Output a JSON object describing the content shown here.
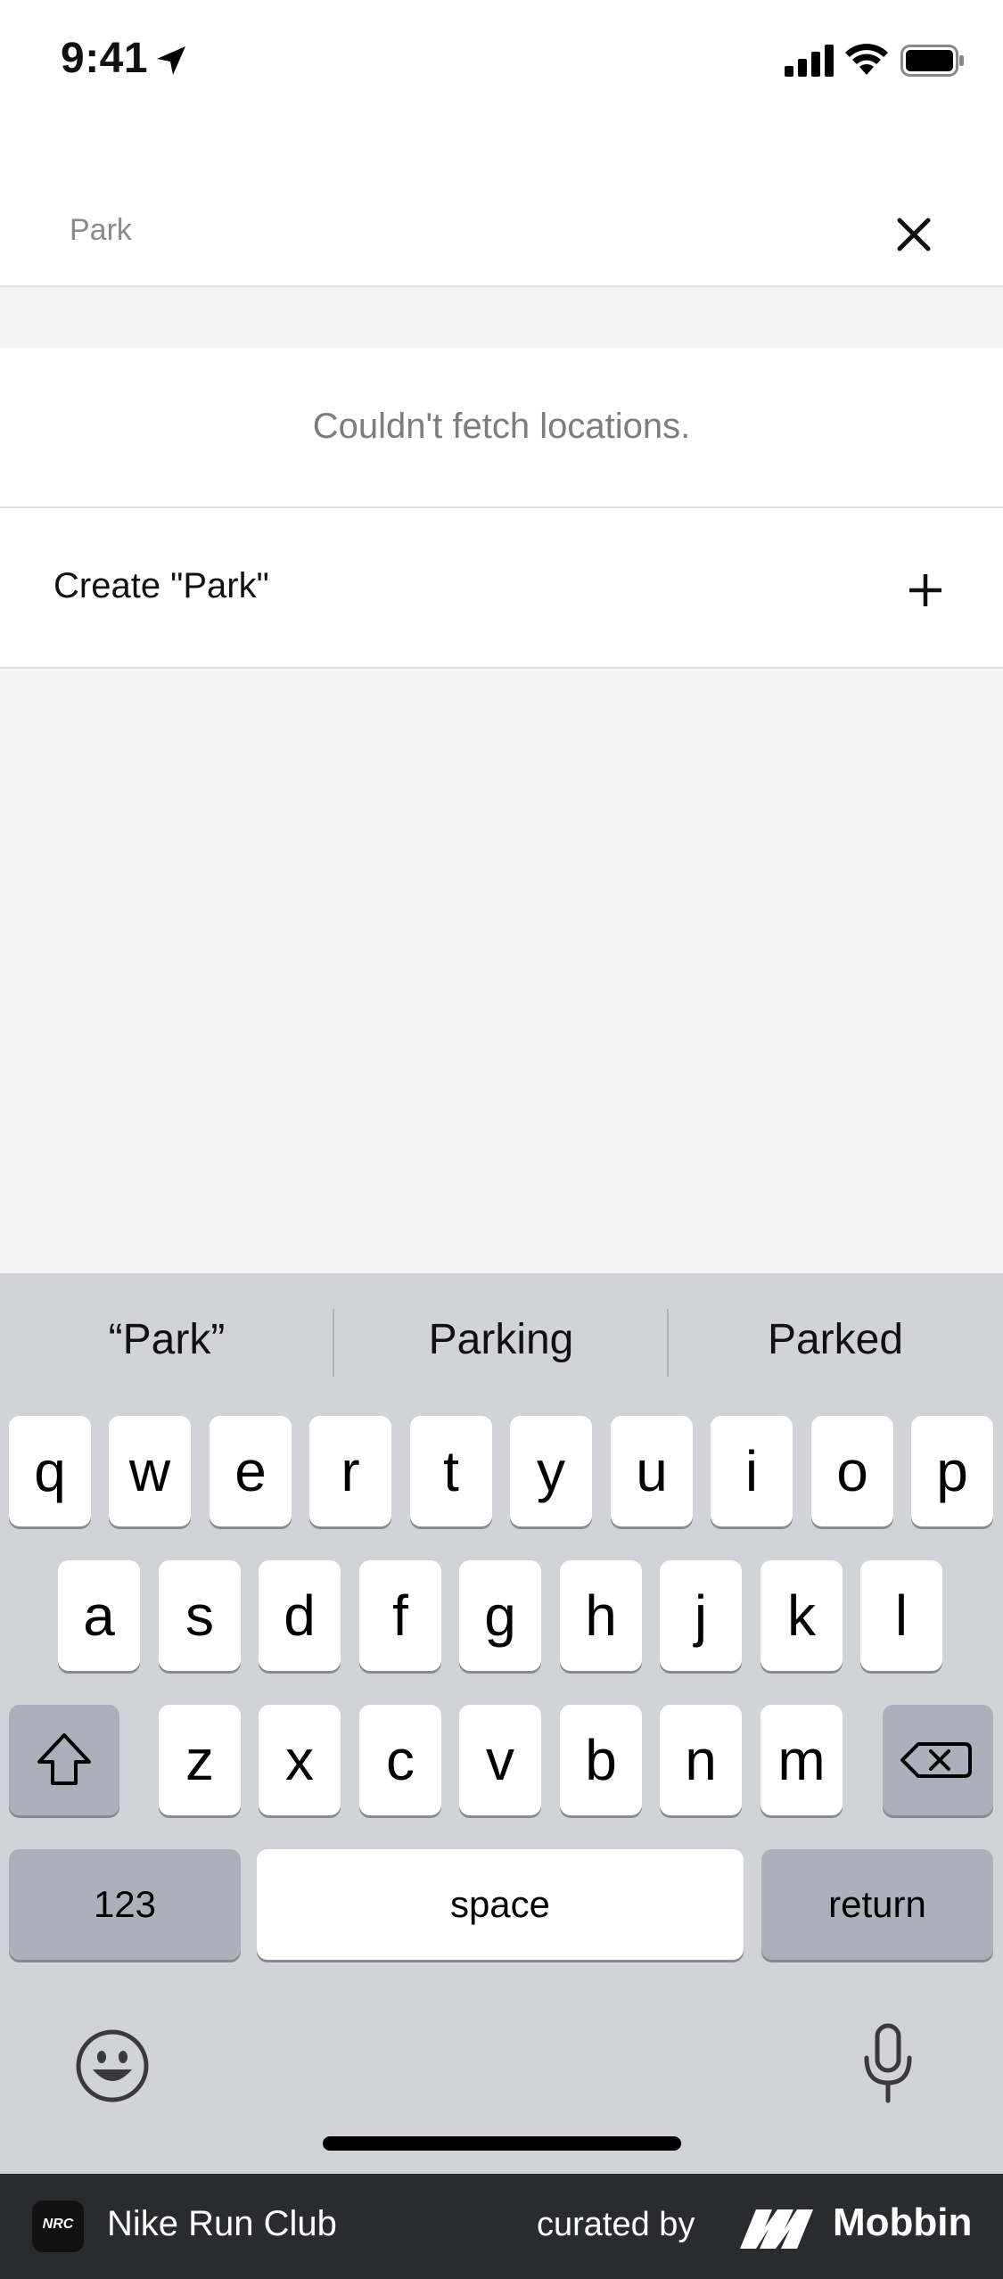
{
  "status_bar": {
    "time": "9:41"
  },
  "search": {
    "value": "Park",
    "placeholder": "Park"
  },
  "results": {
    "error_message": "Couldn't fetch locations.",
    "create_label": "Create \"Park\""
  },
  "keyboard": {
    "suggestions": [
      "“Park”",
      "Parking",
      "Parked"
    ],
    "row1": [
      "q",
      "w",
      "e",
      "r",
      "t",
      "y",
      "u",
      "i",
      "o",
      "p"
    ],
    "row2": [
      "a",
      "s",
      "d",
      "f",
      "g",
      "h",
      "j",
      "k",
      "l"
    ],
    "row3": [
      "z",
      "x",
      "c",
      "v",
      "b",
      "n",
      "m"
    ],
    "numbers_label": "123",
    "space_label": "space",
    "return_label": "return"
  },
  "footer": {
    "app_name": "Nike Run Club",
    "app_logo_text": "NRC",
    "curated_by": "curated by",
    "brand": "Mobbin"
  },
  "colors": {
    "keyboard_bg": "#d1d3d9",
    "content_bg": "#f4f4f4",
    "footer_bg": "#2a2b2e"
  }
}
